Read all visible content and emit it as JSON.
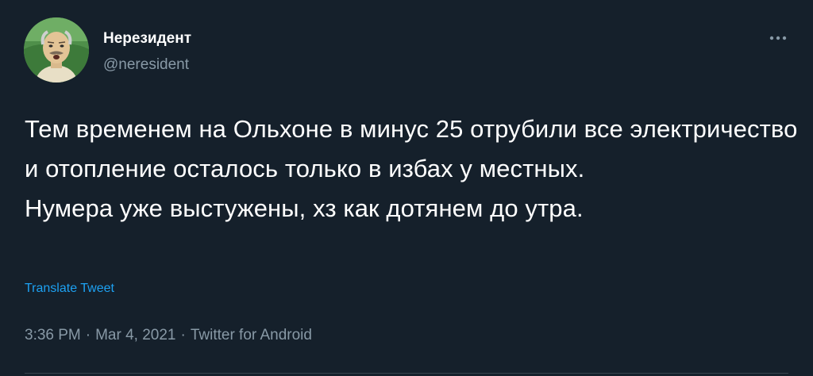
{
  "author": {
    "name": "Нерезидент",
    "handle": "@neresident"
  },
  "more_icon": "more-horizontal-icon",
  "tweet": {
    "text": "Тем временем на Ольхоне в минус 25 отрубили все электричество и отопление осталось только в избах у местных.\nНумера уже выстужены, хз как дотянем до утра.",
    "translate_label": "Translate Tweet"
  },
  "meta": {
    "time": "3:36 PM",
    "separator": "·",
    "date": "Mar 4, 2021",
    "source": "Twitter for Android"
  },
  "colors": {
    "background": "#15202b",
    "primary_text": "#ffffff",
    "secondary_text": "#8899a6",
    "link": "#1da1f2",
    "divider": "#38444d"
  }
}
